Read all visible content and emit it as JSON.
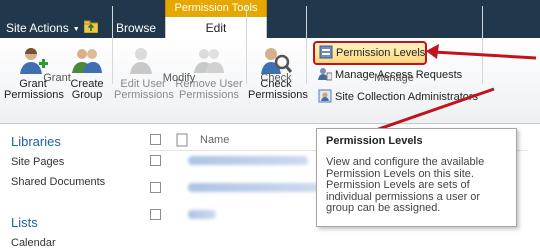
{
  "topbar": {
    "site_actions_label": "Site Actions",
    "tab_browse": "Browse",
    "context_group": "Permission Tools",
    "tab_edit": "Edit"
  },
  "ribbon": {
    "grant_group": {
      "label": "Grant",
      "grant_permissions": [
        "Grant",
        "Permissions"
      ],
      "create_group": [
        "Create",
        "Group"
      ]
    },
    "modify_group": {
      "label": "Modify",
      "edit_user_permissions": [
        "Edit User",
        "Permissions"
      ],
      "remove_user_permissions": [
        "Remove User",
        "Permissions"
      ]
    },
    "check_group": {
      "label": "Check",
      "check_permissions": [
        "Check",
        "Permissions"
      ]
    },
    "manage_group": {
      "label": "Manage",
      "permission_levels": "Permission Levels",
      "manage_access_requests": "Manage Access Requests",
      "site_collection_admins": "Site Collection Administrators"
    }
  },
  "leftnav": {
    "libraries_heading": "Libraries",
    "library_items": [
      "Site Pages",
      "Shared Documents"
    ],
    "lists_heading": "Lists",
    "list_items": [
      "Calendar"
    ]
  },
  "list": {
    "name_header": "Name"
  },
  "tooltip": {
    "title": "Permission Levels",
    "body": "View and configure the available Permission Levels on this site. Permission Levels are sets of individual permissions a user or group can be assigned."
  },
  "colors": {
    "topbar": "#21374c",
    "context_tab": "#e6a800",
    "highlight_border": "#c0141c",
    "nav_heading": "#1f63a3"
  }
}
